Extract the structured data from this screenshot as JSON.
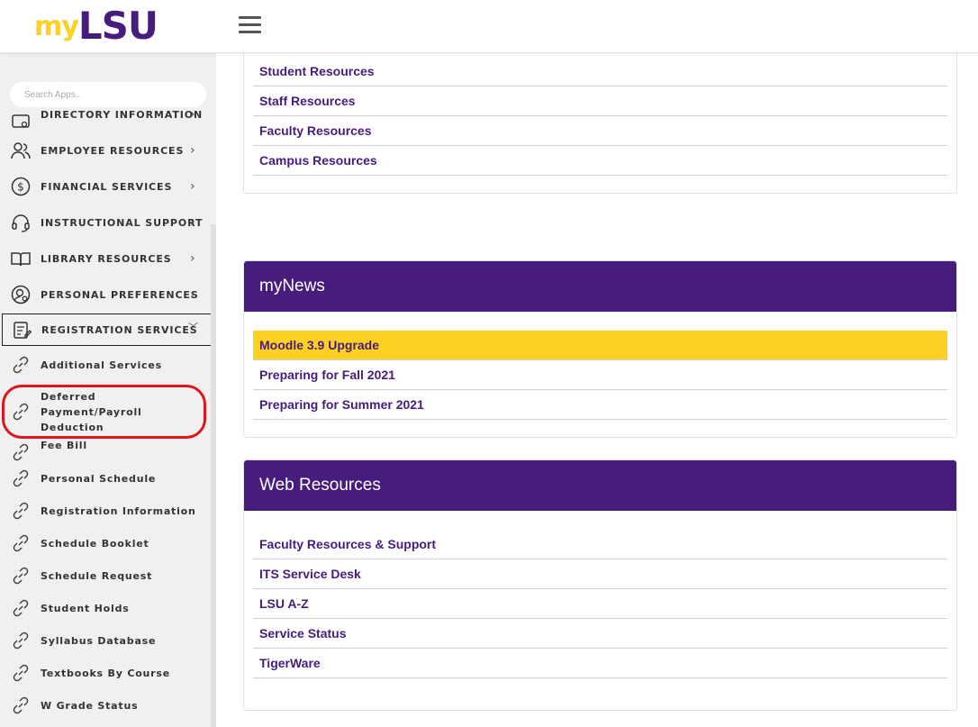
{
  "header": {
    "logo_my": "my",
    "logo_lsu": "LSU"
  },
  "sidebar": {
    "search_placeholder": "Search Apps..",
    "partial_item": "DIRECTORY INFORMATION",
    "categories": [
      {
        "label": "EMPLOYEE RESOURCES",
        "icon": "people-icon"
      },
      {
        "label": "FINANCIAL SERVICES",
        "icon": "dollar-circle-icon"
      },
      {
        "label": "INSTRUCTIONAL SUPPORT",
        "icon": "headset-icon"
      },
      {
        "label": "LIBRARY RESOURCES",
        "icon": "open-book-icon"
      },
      {
        "label": "PERSONAL PREFERENCES",
        "icon": "user-gear-icon"
      },
      {
        "label": "REGISTRATION SERVICES",
        "icon": "document-edit-icon"
      }
    ],
    "chevron_right": "›",
    "chevron_down": "﹀",
    "sub_items": [
      "Additional Services",
      "Deferred Payment/Payroll Deduction",
      "Fee Bill",
      "Personal Schedule",
      "Registration Information",
      "Schedule Booklet",
      "Schedule Request",
      "Student Holds",
      "Syllabus Database",
      "Textbooks By Course",
      "W Grade Status"
    ]
  },
  "main": {
    "resources_card": {
      "links": [
        "Student Resources",
        "Staff Resources",
        "Faculty Resources",
        "Campus Resources"
      ]
    },
    "mynews_card": {
      "title": "myNews",
      "links": [
        "Moodle 3.9 Upgrade",
        "Preparing for Fall 2021",
        "Preparing for Summer 2021"
      ]
    },
    "web_card": {
      "title": "Web Resources",
      "links": [
        "Faculty Resources & Support",
        "ITS Service Desk",
        "LSU A-Z",
        "Service Status",
        "TigerWare"
      ]
    }
  },
  "colors": {
    "lsu_purple": "#461d7c",
    "lsu_gold": "#fdd023",
    "highlight_red": "#e0141c"
  }
}
